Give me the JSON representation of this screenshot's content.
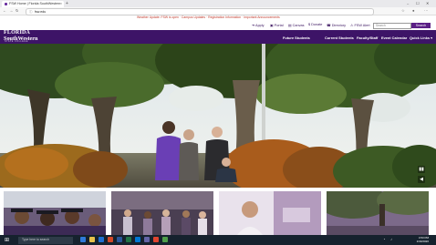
{
  "browser": {
    "tab_title": "FSW Home | Florida SouthWestern",
    "tab_close": "×",
    "new_tab": "+",
    "window_controls": [
      "–",
      "☐",
      "✕"
    ],
    "address": "fsw.edu",
    "security_label": "Not secure"
  },
  "alert_text": "Weather Update: FSW is open · Campus Updates · Registration Information · Important Announcements",
  "utility_bar": {
    "links": [
      {
        "label": "Apply",
        "icon": "apply-icon"
      },
      {
        "label": "Portal",
        "icon": "portal-icon"
      },
      {
        "label": "Canvas",
        "icon": "canvas-icon"
      },
      {
        "label": "Donate",
        "icon": "donate-icon"
      },
      {
        "label": "Directory",
        "icon": "directory-icon"
      },
      {
        "label": "FSW Alert",
        "icon": "alert-icon"
      }
    ],
    "search_placeholder": "Search",
    "search_button": "Search"
  },
  "logo": {
    "line1": "FLORIDA",
    "line2": "SouthWestern",
    "line3": "STATE COLLEGE"
  },
  "main_nav": [
    "Future Students",
    "Current Students",
    "Faculty/Staff",
    "Event Calendar",
    "Quick Links"
  ],
  "hero": {
    "controls": [
      "▮▮",
      "◀"
    ]
  },
  "taskbar": {
    "search_placeholder": "Type here to search",
    "time": "4:53 PM",
    "date": "1/30/2020"
  },
  "colors": {
    "brand_purple": "#3d1467",
    "button_purple": "#5b1f86",
    "taskbar": "#16222e"
  }
}
